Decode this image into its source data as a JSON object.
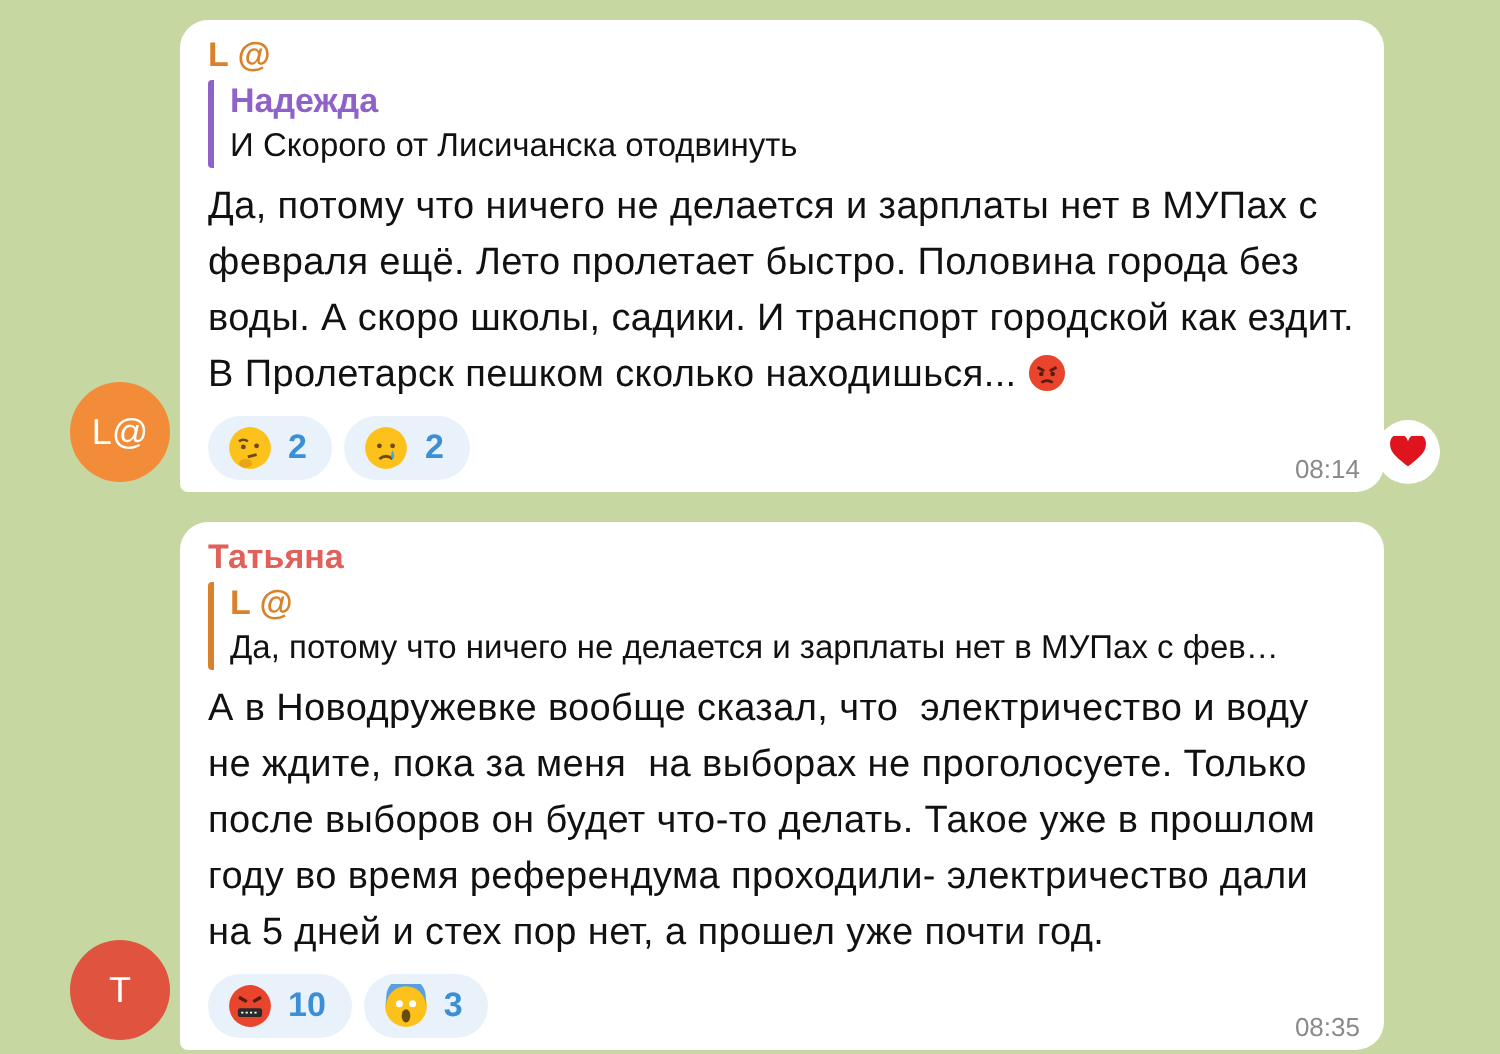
{
  "messages": [
    {
      "author": "L @",
      "color": "#d9822b",
      "avatar": {
        "text": "L@",
        "color": "#f28c38"
      },
      "reply": {
        "author": "Надежда",
        "color": "#8e62c8",
        "text": "И Скорого от Лисичанска отодвинуть"
      },
      "text": "Да, потому что ничего не делается и зарплаты нет в МУПах с февраля ещё. Лето пролетает быстро. Половина города без воды. А скоро школы, садики. И транспорт городской как ездит. В Пролетарск пешком сколько находишься...",
      "trailing_emoji": {
        "kind": "angry"
      },
      "reactions": [
        {
          "kind": "thinking",
          "count": "2"
        },
        {
          "kind": "crying",
          "count": "2"
        }
      ],
      "time": "08:14",
      "outside_reaction": {
        "kind": "heart"
      }
    },
    {
      "author": "Татьяна",
      "color": "#e0605a",
      "avatar": {
        "text": "Т",
        "color": "#e0533f"
      },
      "reply": {
        "author": "L @",
        "color": "#d9822b",
        "text": "Да, потому что ничего не делается и зарплаты нет в МУПах с фев…"
      },
      "text": "А в Новодружевке вообще сказал, что  электричество и воду не ждите, пока за меня  на выборах не проголосуете. Только после выборов он будет что-то делать. Такое уже в прошлом году во время референдума проходили- электричество дали на 5 дней и стех пор нет, а прошел уже почти год.",
      "reactions": [
        {
          "kind": "cursing",
          "count": "10"
        },
        {
          "kind": "screaming",
          "count": "3"
        }
      ],
      "time": "08:35"
    }
  ]
}
